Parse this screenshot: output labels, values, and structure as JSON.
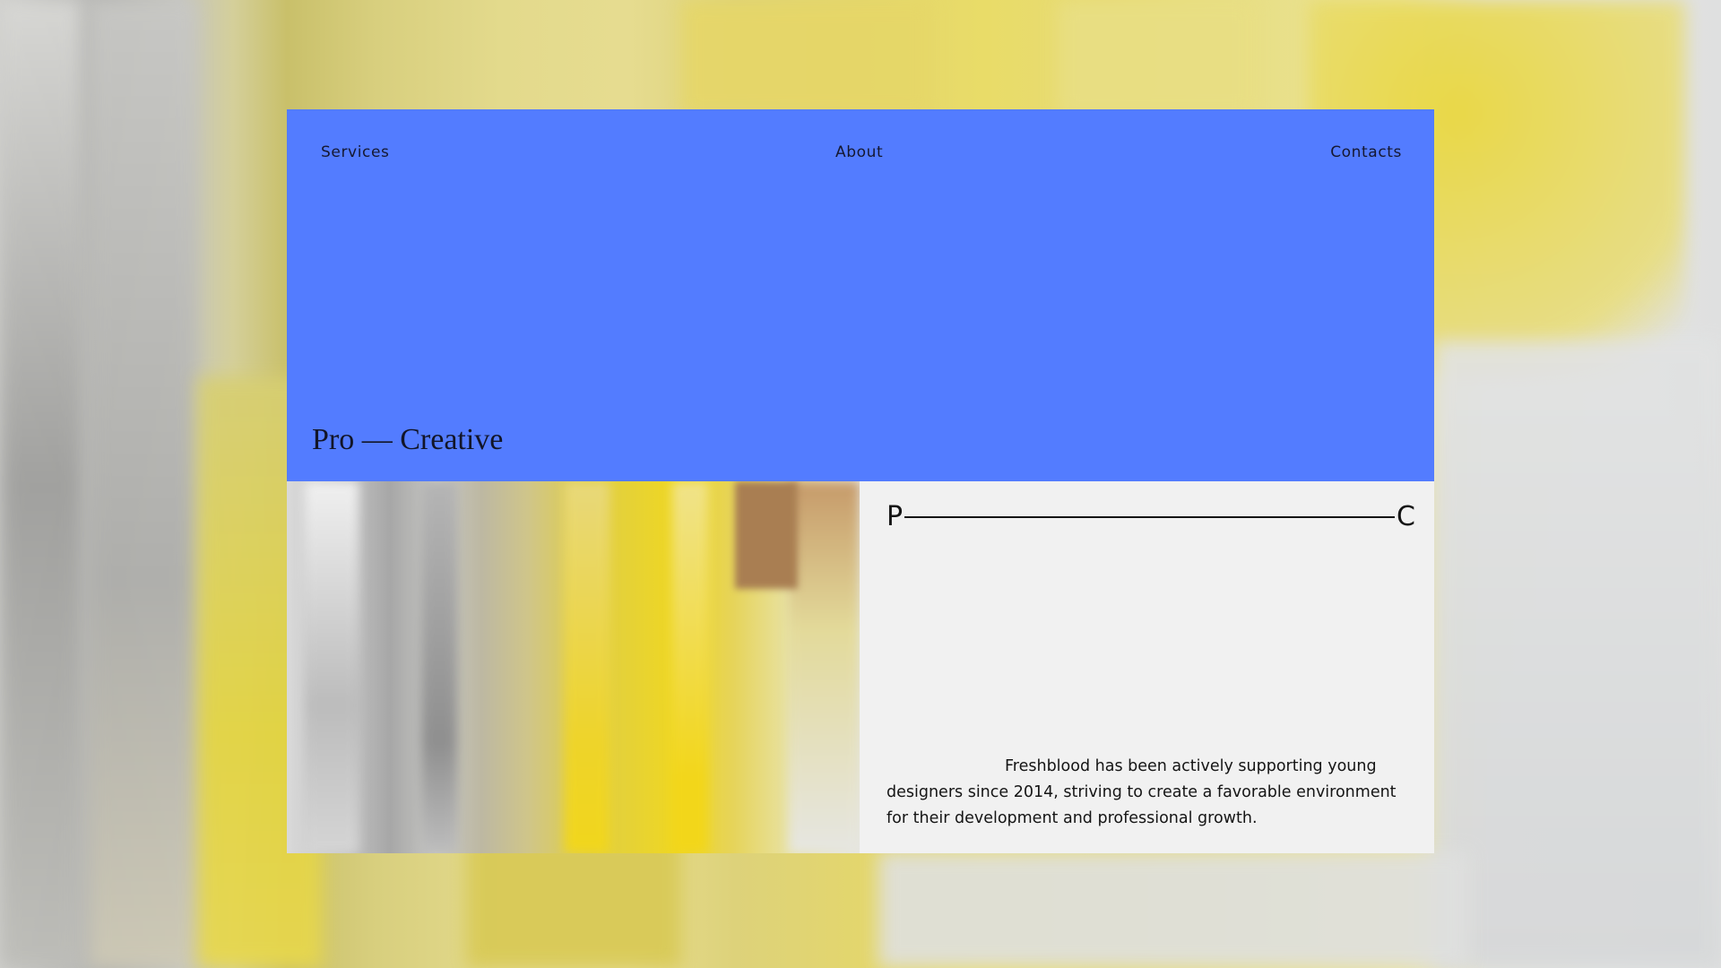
{
  "nav": {
    "services": "Services",
    "about": "About",
    "contacts": "Contacts"
  },
  "hero": {
    "title": "Pro — Creative"
  },
  "info": {
    "start_letter": "P",
    "end_letter": "C",
    "description": "Freshblood has been actively supporting young designers since 2014, striving to create a favorable environment for their development and professional growth."
  },
  "colors": {
    "hero_background": "#537cff",
    "info_background": "#f1f1f1",
    "accent_yellow": "#e8d62a"
  }
}
